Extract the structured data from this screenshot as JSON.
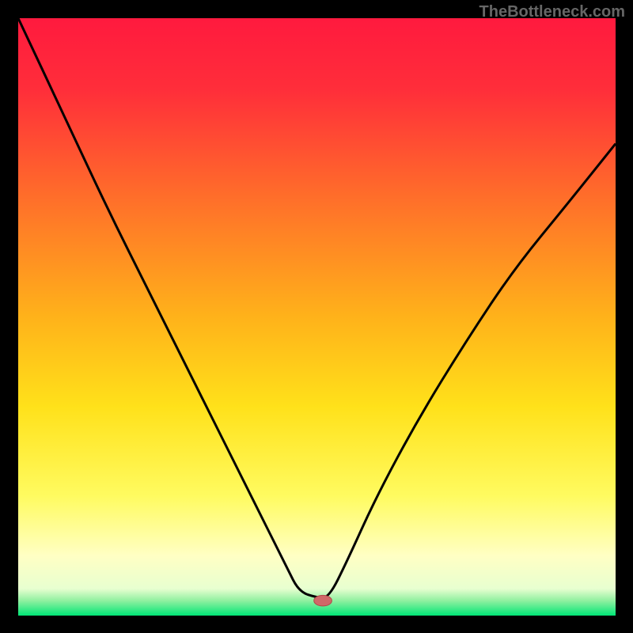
{
  "attribution": "TheBottleneck.com",
  "colors": {
    "frame": "#000000",
    "curve": "#000000",
    "marker_fill": "#d06868",
    "marker_stroke": "#b04848"
  },
  "chart_data": {
    "type": "line",
    "title": "",
    "xlabel": "",
    "ylabel": "",
    "xlim": [
      0,
      100
    ],
    "ylim": [
      0,
      100
    ],
    "gradient_stops": [
      {
        "offset": 0.0,
        "color": "#ff1a3e"
      },
      {
        "offset": 0.12,
        "color": "#ff2e3a"
      },
      {
        "offset": 0.3,
        "color": "#ff6e2a"
      },
      {
        "offset": 0.5,
        "color": "#ffb21a"
      },
      {
        "offset": 0.65,
        "color": "#ffe11a"
      },
      {
        "offset": 0.8,
        "color": "#fffb60"
      },
      {
        "offset": 0.9,
        "color": "#ffffc4"
      },
      {
        "offset": 0.955,
        "color": "#e8ffd0"
      },
      {
        "offset": 0.975,
        "color": "#90f0a0"
      },
      {
        "offset": 1.0,
        "color": "#00e676"
      }
    ],
    "notch_floor_y": 97.0,
    "series": [
      {
        "name": "bottleneck-curve",
        "x": [
          0.0,
          8.0,
          15.0,
          22.0,
          30.0,
          38.0,
          45.0,
          47.0,
          50.0,
          52.0,
          55.0,
          60.0,
          67.0,
          75.0,
          83.0,
          92.0,
          100.0
        ],
        "y": [
          0.0,
          17.0,
          32.0,
          46.0,
          62.0,
          78.0,
          92.0,
          96.0,
          97.0,
          97.0,
          91.0,
          80.0,
          67.0,
          54.0,
          42.0,
          31.0,
          21.0
        ]
      }
    ],
    "marker": {
      "x": 51.0,
      "y": 97.5,
      "rx": 1.5,
      "ry": 0.9
    }
  }
}
